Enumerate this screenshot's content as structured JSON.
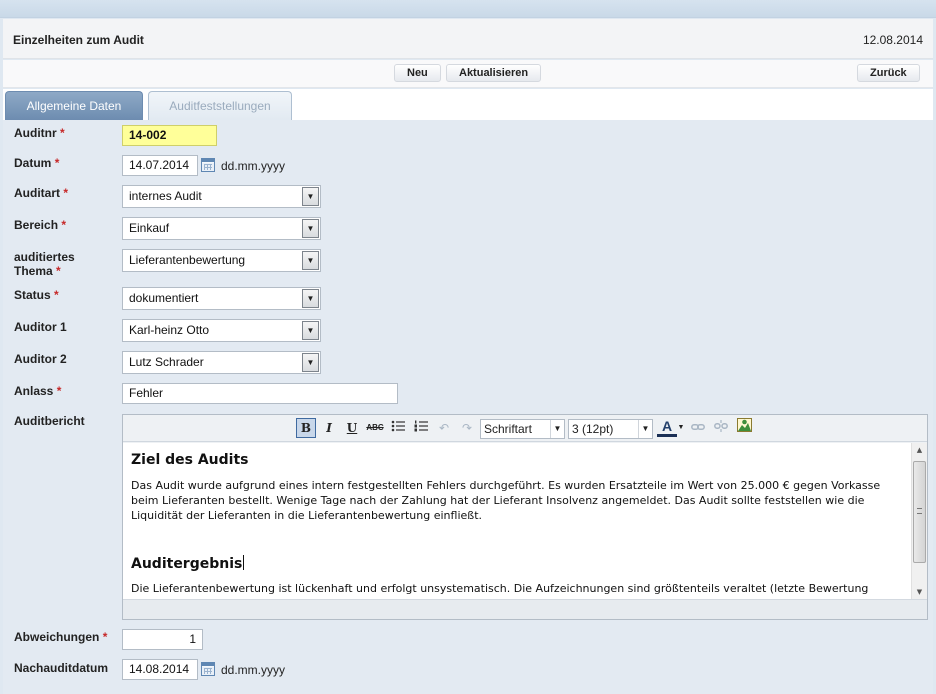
{
  "header": {
    "title": "Einzelheiten zum Audit",
    "date": "12.08.2014"
  },
  "toolbar": {
    "new_label": "Neu",
    "refresh_label": "Aktualisieren",
    "back_label": "Zurück"
  },
  "tabs": [
    {
      "label": "Allgemeine Daten",
      "active": true
    },
    {
      "label": "Auditfeststellungen",
      "active": false
    }
  ],
  "required_mark": "*",
  "form": {
    "auditnr": {
      "label": "Auditnr",
      "value": "14-002"
    },
    "datum": {
      "label": "Datum",
      "value": "14.07.2014",
      "hint": "dd.mm.yyyy"
    },
    "auditart": {
      "label": "Auditart",
      "value": "internes Audit"
    },
    "bereich": {
      "label": "Bereich",
      "value": "Einkauf"
    },
    "thema": {
      "label_line1": "auditiertes",
      "label_line2": "Thema",
      "value": "Lieferantenbewertung"
    },
    "status": {
      "label": "Status",
      "value": "dokumentiert"
    },
    "auditor1": {
      "label": "Auditor 1",
      "value": "Karl-heinz Otto"
    },
    "auditor2": {
      "label": "Auditor 2",
      "value": "Lutz Schrader"
    },
    "anlass": {
      "label": "Anlass",
      "value": "Fehler"
    },
    "auditbericht": {
      "label": "Auditbericht"
    },
    "abweichungen": {
      "label": "Abweichungen",
      "value": "1"
    },
    "nachauditdatum": {
      "label": "Nachauditdatum",
      "value": "14.08.2014",
      "hint": "dd.mm.yyyy"
    }
  },
  "editor": {
    "toolbar": {
      "bold": "B",
      "italic": "I",
      "underline": "U",
      "strike": "ABC",
      "font_select": "Schriftart",
      "size_select": "3 (12pt)",
      "font_color": "A"
    },
    "heading1": "Ziel des Audits",
    "paragraph1": "Das Audit wurde aufgrund eines intern festgestellten Fehlers durchgeführt. Es wurden Ersatzteile im Wert von 25.000 € gegen Vorkasse beim Lieferanten bestellt. Wenige Tage nach der Zahlung hat der Lieferant Insolvenz angemeldet. Das Audit sollte feststellen wie die Liquidität der Lieferanten in die Lieferantenbewertung einfließt.",
    "heading2": "Auditergebnis",
    "paragraph2": "Die Lieferantenbewertung ist lückenhaft und erfolgt unsystematisch. Die Aufzeichnungen sind größtenteils veraltet (letzte Bewertung"
  }
}
